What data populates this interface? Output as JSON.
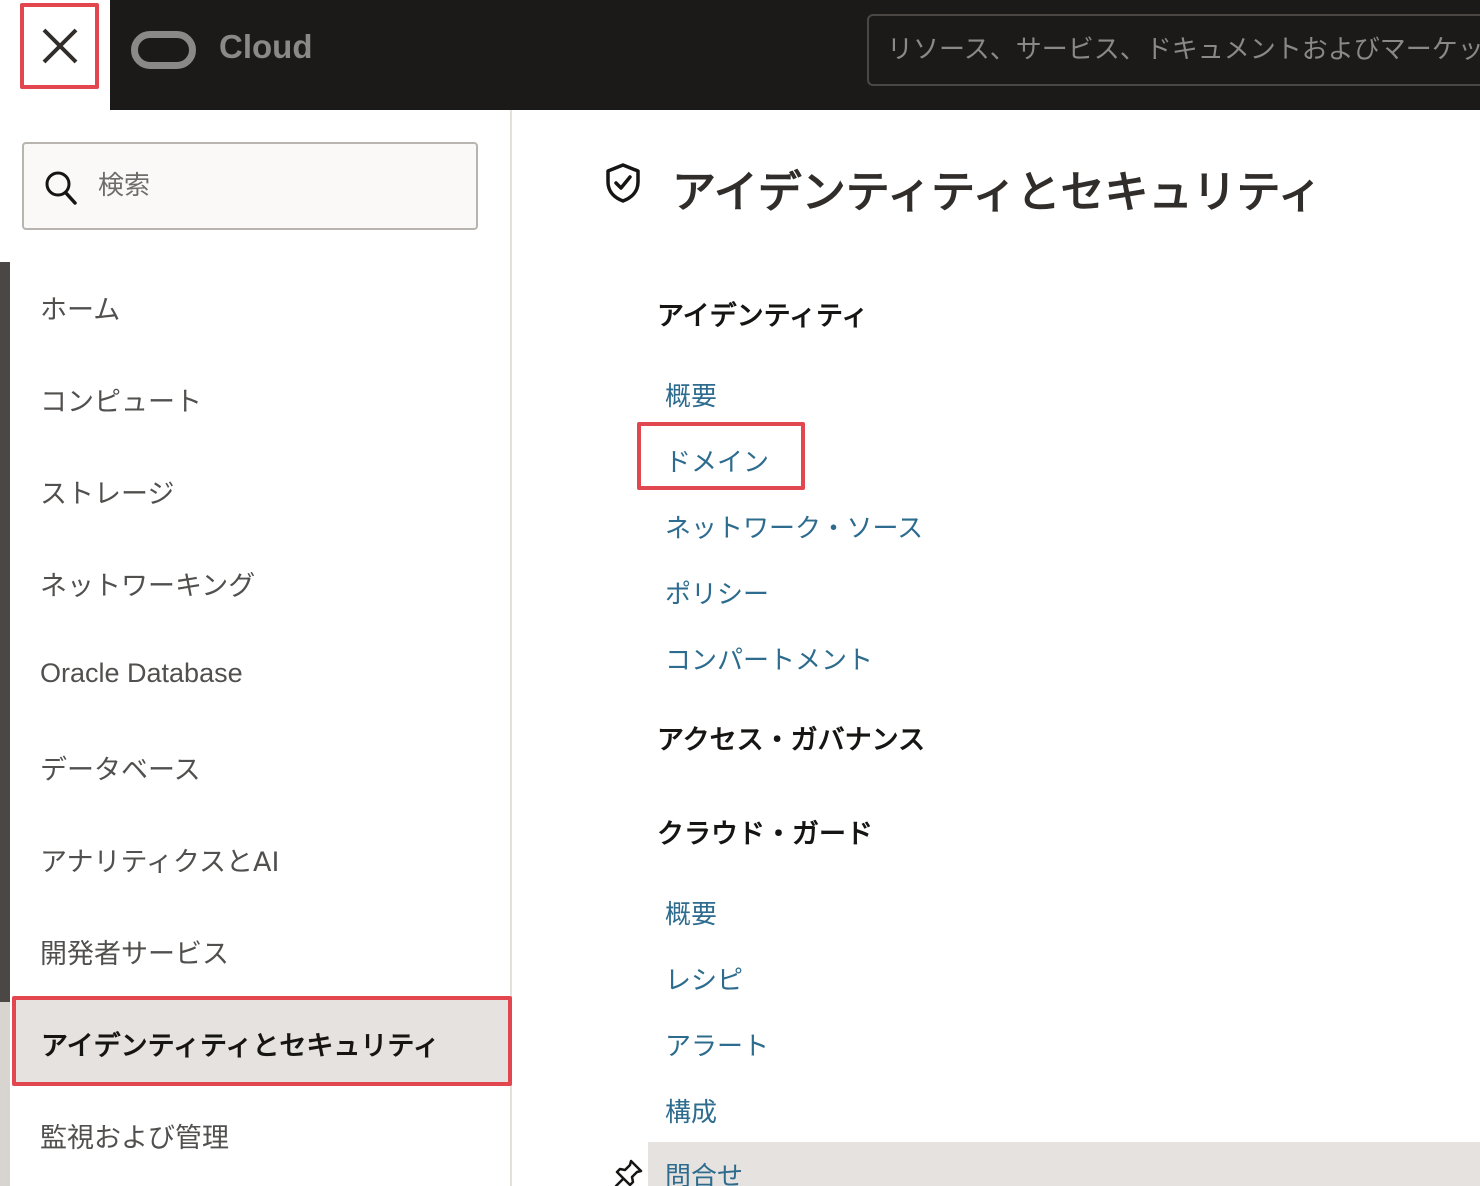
{
  "header": {
    "close_icon": "close-icon",
    "logo_text": "Cloud",
    "search_placeholder": "リソース、サービス、ドキュメントおよびマーケットプレイスの検索"
  },
  "sidebar": {
    "search_placeholder": "検索",
    "items": [
      {
        "label": "ホーム"
      },
      {
        "label": "コンピュート"
      },
      {
        "label": "ストレージ"
      },
      {
        "label": "ネットワーキング"
      },
      {
        "label": "Oracle Database"
      },
      {
        "label": "データベース"
      },
      {
        "label": "アナリティクスとAI"
      },
      {
        "label": "開発者サービス"
      },
      {
        "label": "アイデンティティとセキュリティ",
        "active": true
      },
      {
        "label": "監視および管理"
      }
    ]
  },
  "main": {
    "title": "アイデンティティとセキュリティ",
    "title_icon": "shield-check-icon",
    "sections": [
      {
        "heading": "アイデンティティ",
        "links": [
          "概要",
          "ドメイン",
          "ネットワーク・ソース",
          "ポリシー",
          "コンパートメント"
        ]
      },
      {
        "heading": "アクセス・ガバナンス",
        "links": []
      },
      {
        "heading": "クラウド・ガード",
        "links": [
          "概要",
          "レシピ",
          "アラート",
          "構成",
          "問合せ"
        ]
      }
    ]
  },
  "colors": {
    "accent_red": "#e2464f",
    "link_blue": "#2d6c8e",
    "header_bg": "#1b1a19"
  }
}
